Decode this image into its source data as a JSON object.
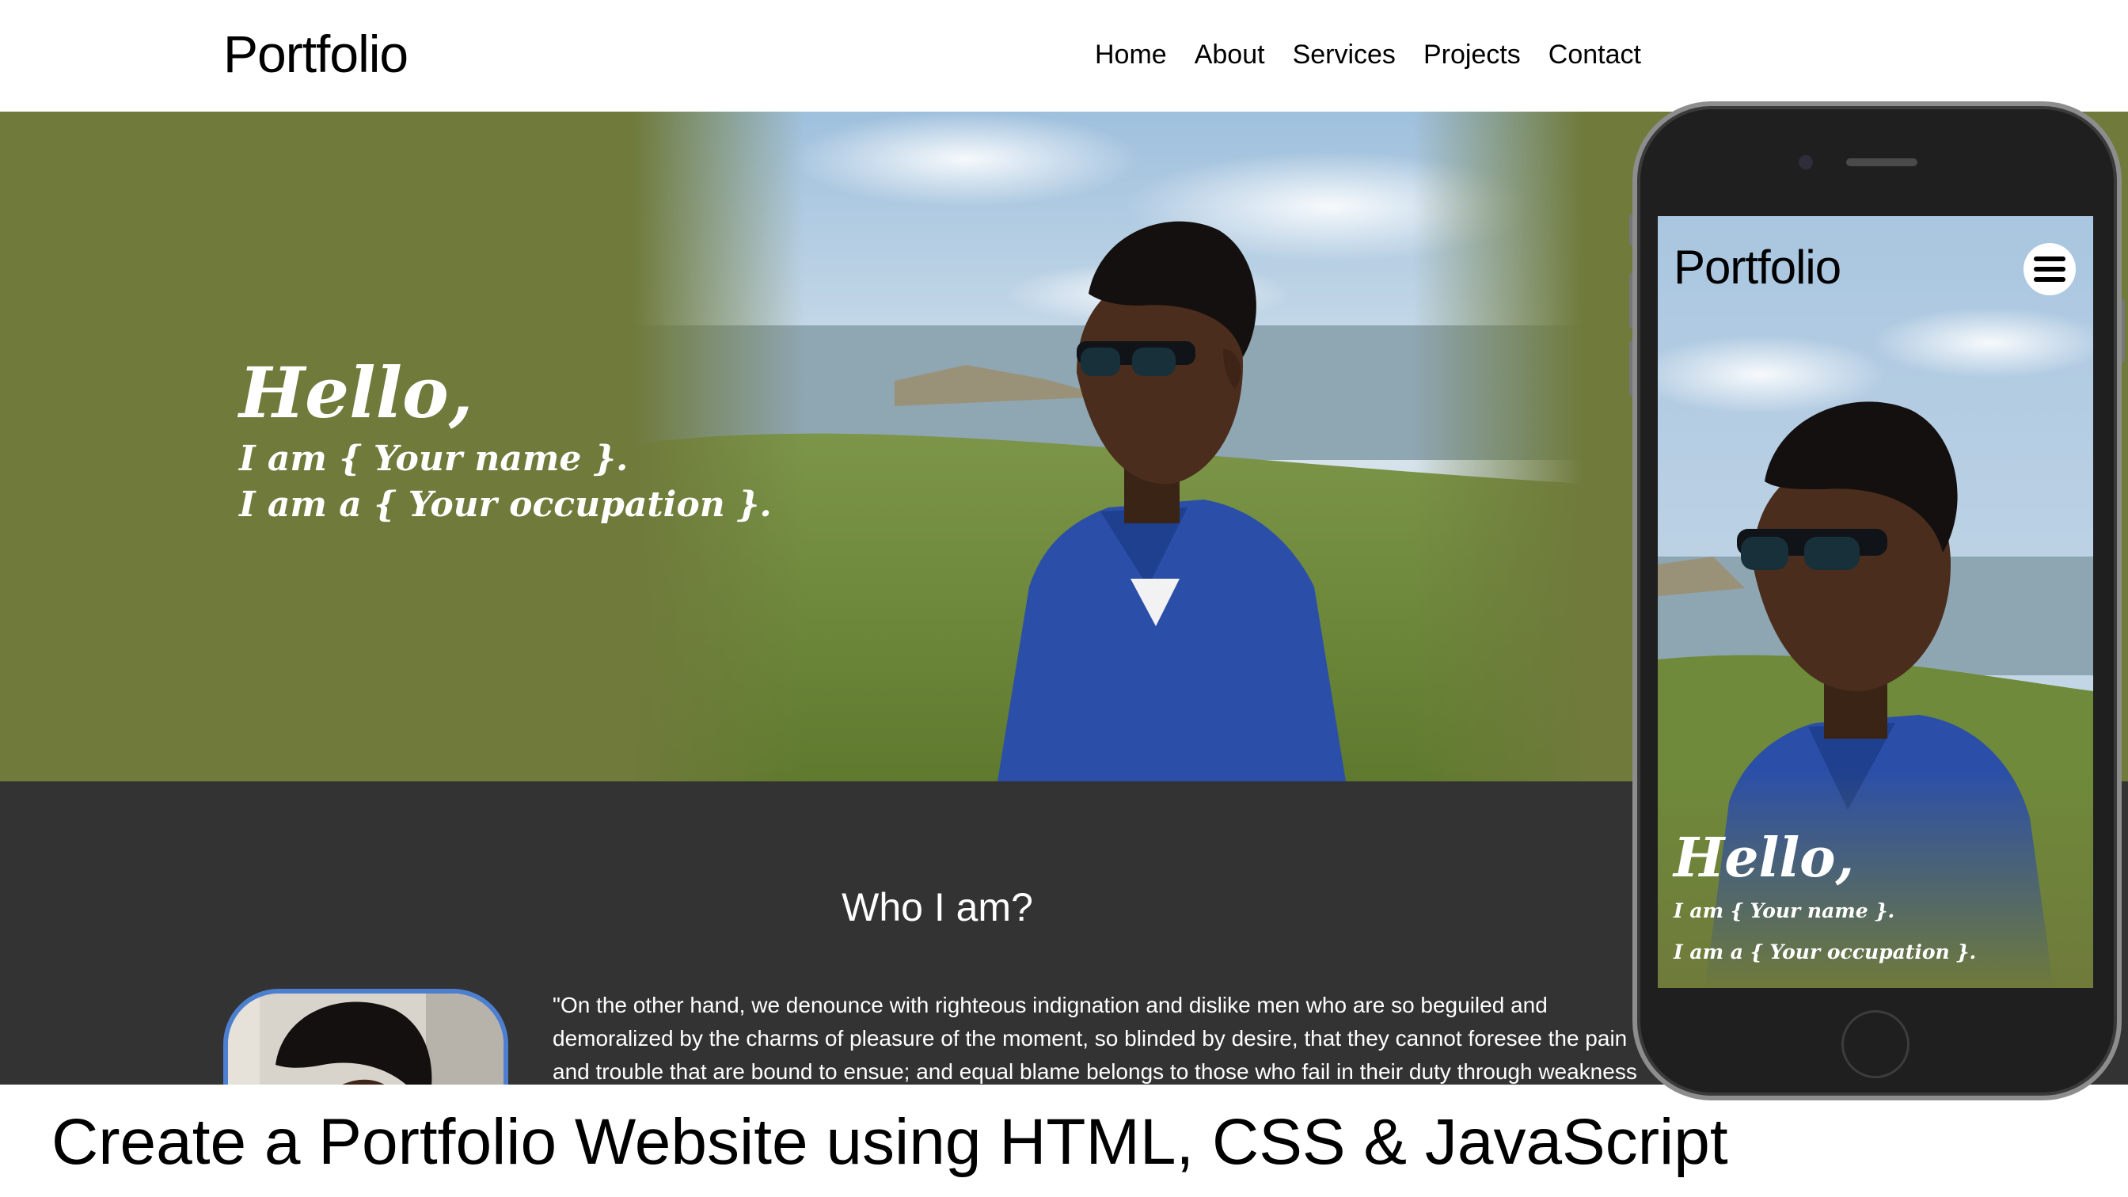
{
  "desktop": {
    "logo": "Portfolio",
    "nav": [
      "Home",
      "About",
      "Services",
      "Projects",
      "Contact"
    ],
    "hero": {
      "hello": "Hello,",
      "line1": "I am { Your name }.",
      "line2": "I am a { Your occupation }."
    },
    "about": {
      "title": "Who I am?",
      "paragraph": "\"On the other hand, we denounce with righteous indignation and dislike men who are so beguiled and demoralized by the charms of pleasure of the moment, so blinded by desire, that they cannot foresee the pain and trouble that are bound to ensue; and equal blame belongs to those who fail in their duty through weakness"
    }
  },
  "mobile": {
    "logo": "Portfolio",
    "menu_icon": "hamburger-menu-icon",
    "hero": {
      "hello": "Hello,",
      "line1": "I am { Your name }.",
      "line2": "I am a { Your occupation }."
    }
  },
  "caption": "Create a Portfolio Website using HTML, CSS & JavaScript",
  "colors": {
    "hero_green": "#6f7a3b",
    "about_bg": "#333333",
    "avatar_border": "#4d7fd1",
    "shirt_blue": "#2b4fa8"
  }
}
